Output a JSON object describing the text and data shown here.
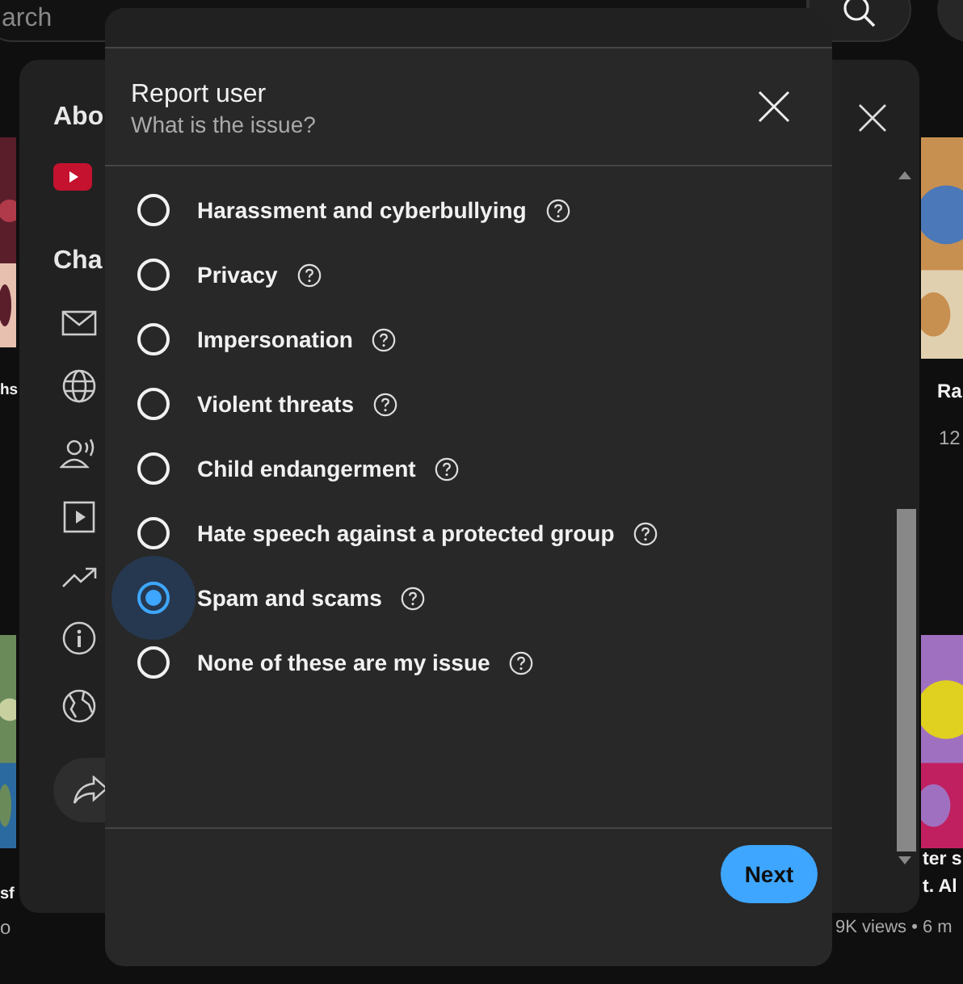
{
  "page": {
    "search": {
      "placeholder": "arch"
    },
    "snippets": [
      {
        "text": "hs"
      },
      {
        "text": "sf"
      },
      {
        "text": "o"
      },
      {
        "text": "Ra"
      },
      {
        "text": "12"
      },
      {
        "text": "ter s"
      },
      {
        "text": "t. Al"
      },
      {
        "text": "9K views • 6 m"
      }
    ]
  },
  "about_panel": {
    "heading_1": "Abo",
    "heading_2": "Cha"
  },
  "dialog": {
    "title": "Report user",
    "subtitle": "What is the issue?",
    "options": [
      {
        "label": "Harassment and cyberbullying",
        "selected": false
      },
      {
        "label": "Privacy",
        "selected": false
      },
      {
        "label": "Impersonation",
        "selected": false
      },
      {
        "label": "Violent threats",
        "selected": false
      },
      {
        "label": "Child endangerment",
        "selected": false
      },
      {
        "label": "Hate speech against a protected group",
        "selected": false
      },
      {
        "label": "Spam and scams",
        "selected": true
      },
      {
        "label": "None of these are my issue",
        "selected": false
      }
    ],
    "next_button": "Next"
  }
}
